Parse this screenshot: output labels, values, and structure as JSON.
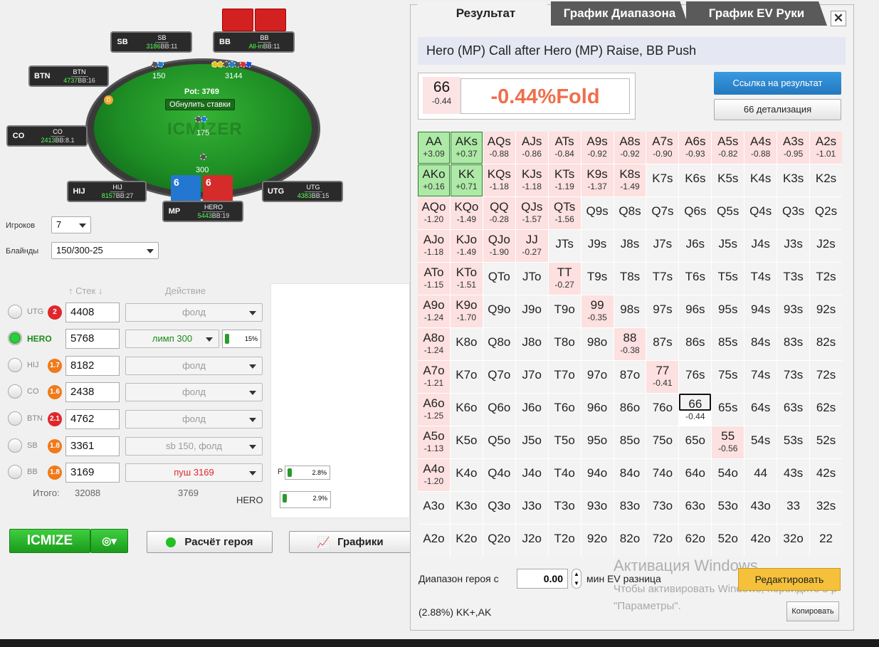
{
  "table": {
    "logo": "ICMIZER",
    "pot_label": "Pot: 3769",
    "reset_bets": "Обнулить ставки",
    "dealer": "D",
    "seats": {
      "sb": {
        "pos": "SB",
        "name": "SB",
        "stack": "3186",
        "bb": "BB:11"
      },
      "bb": {
        "pos": "BB",
        "name": "BB",
        "stack": "All-in",
        "bb": "BB:11"
      },
      "btn": {
        "pos": "BTN",
        "name": "BTN",
        "stack": "4737",
        "bb": "BB:16"
      },
      "co": {
        "pos": "CO",
        "name": "CO",
        "stack": "2413",
        "bb": "BB:8.1"
      },
      "hij": {
        "pos": "HIJ",
        "name": "HIJ",
        "stack": "8157",
        "bb": "BB:27"
      },
      "utg": {
        "pos": "UTG",
        "name": "UTG",
        "stack": "4383",
        "bb": "BB:15"
      },
      "mp": {
        "pos": "MP",
        "name": "HERO",
        "stack": "5443",
        "bb": "BB:19"
      }
    },
    "bets": {
      "sb": "150",
      "bb": "3144",
      "center": "175",
      "hero": "300"
    },
    "hero_cards": [
      "6",
      "6"
    ]
  },
  "controls": {
    "players_label": "Игроков",
    "players_value": "7",
    "blinds_label": "Блайнды",
    "blinds_value": "150/300-25",
    "stack_header": "Стек",
    "action_header": "Действие",
    "rows": [
      {
        "pos": "UTG",
        "badge": "2",
        "badge_color": "#e0262b",
        "stack": "4408",
        "action": "фолд",
        "color": "#999"
      },
      {
        "pos": "HERO",
        "badge": "",
        "badge_color": "",
        "stack": "5768",
        "action": "лимп 300",
        "color": "#1a8c1a",
        "pct": "15%"
      },
      {
        "pos": "HIJ",
        "badge": "1.7",
        "badge_color": "#f07a1a",
        "stack": "8182",
        "action": "фолд",
        "color": "#999"
      },
      {
        "pos": "CO",
        "badge": "1.6",
        "badge_color": "#f07a1a",
        "stack": "2438",
        "action": "фолд",
        "color": "#999"
      },
      {
        "pos": "BTN",
        "badge": "2.1",
        "badge_color": "#e0262b",
        "stack": "4762",
        "action": "фолд",
        "color": "#999"
      },
      {
        "pos": "SB",
        "badge": "1.8",
        "badge_color": "#f07a1a",
        "stack": "3361",
        "action": "sb 150, фолд",
        "color": "#999"
      },
      {
        "pos": "BB",
        "badge": "1.8",
        "badge_color": "#f07a1a",
        "stack": "3169",
        "action": "пуш 3169",
        "color": "#e0262b"
      }
    ],
    "total_label": "Итого:",
    "total_stack": "32088",
    "total_action": "3769",
    "p_label": "P",
    "p_pct": "2.8%",
    "hero_label": "HERO",
    "hero_pct": "2.9%",
    "icmize_btn": "ICMIZE",
    "hero_calc_btn": "Расчёт героя",
    "charts_btn": "Графики"
  },
  "panel": {
    "tabs": [
      "Результат",
      "График Диапазона",
      "График EV Руки"
    ],
    "close": "✕",
    "title": "Hero (MP) Call after Hero (MP) Raise, BB Push",
    "hand": "66",
    "hand_ev": "-0.44",
    "result": "-0.44%Fold",
    "link_btn": "Ссылка на результат",
    "detail_btn": "66 детализация",
    "grid": [
      [
        [
          "AA",
          "+3.09",
          "p"
        ],
        [
          "AKs",
          "+0.37",
          "p"
        ],
        [
          "AQs",
          "-0.88",
          "n"
        ],
        [
          "AJs",
          "-0.86",
          "n"
        ],
        [
          "ATs",
          "-0.84",
          "n"
        ],
        [
          "A9s",
          "-0.92",
          "n"
        ],
        [
          "A8s",
          "-0.92",
          "n"
        ],
        [
          "A7s",
          "-0.90",
          "n"
        ],
        [
          "A6s",
          "-0.93",
          "n"
        ],
        [
          "A5s",
          "-0.82",
          "n"
        ],
        [
          "A4s",
          "-0.88",
          "n"
        ],
        [
          "A3s",
          "-0.95",
          "n"
        ],
        [
          "A2s",
          "-1.01",
          "n"
        ]
      ],
      [
        [
          "AKo",
          "+0.16",
          "p"
        ],
        [
          "KK",
          "+0.71",
          "p"
        ],
        [
          "KQs",
          "-1.18",
          "n"
        ],
        [
          "KJs",
          "-1.18",
          "n"
        ],
        [
          "KTs",
          "-1.19",
          "n"
        ],
        [
          "K9s",
          "-1.37",
          "n"
        ],
        [
          "K8s",
          "-1.49",
          "n"
        ],
        [
          "K7s",
          "",
          ""
        ],
        [
          "K6s",
          "",
          ""
        ],
        [
          "K5s",
          "",
          ""
        ],
        [
          "K4s",
          "",
          ""
        ],
        [
          "K3s",
          "",
          ""
        ],
        [
          "K2s",
          "",
          ""
        ]
      ],
      [
        [
          "AQo",
          "-1.20",
          "n"
        ],
        [
          "KQo",
          "-1.49",
          "n"
        ],
        [
          "QQ",
          "-0.28",
          "n"
        ],
        [
          "QJs",
          "-1.57",
          "n"
        ],
        [
          "QTs",
          "-1.56",
          "n"
        ],
        [
          "Q9s",
          "",
          ""
        ],
        [
          "Q8s",
          "",
          ""
        ],
        [
          "Q7s",
          "",
          ""
        ],
        [
          "Q6s",
          "",
          ""
        ],
        [
          "Q5s",
          "",
          ""
        ],
        [
          "Q4s",
          "",
          ""
        ],
        [
          "Q3s",
          "",
          ""
        ],
        [
          "Q2s",
          "",
          ""
        ]
      ],
      [
        [
          "AJo",
          "-1.18",
          "n"
        ],
        [
          "KJo",
          "-1.49",
          "n"
        ],
        [
          "QJo",
          "-1.90",
          "n"
        ],
        [
          "JJ",
          "-0.27",
          "n"
        ],
        [
          "JTs",
          "",
          ""
        ],
        [
          "J9s",
          "",
          ""
        ],
        [
          "J8s",
          "",
          ""
        ],
        [
          "J7s",
          "",
          ""
        ],
        [
          "J6s",
          "",
          ""
        ],
        [
          "J5s",
          "",
          ""
        ],
        [
          "J4s",
          "",
          ""
        ],
        [
          "J3s",
          "",
          ""
        ],
        [
          "J2s",
          "",
          ""
        ]
      ],
      [
        [
          "ATo",
          "-1.15",
          "n"
        ],
        [
          "KTo",
          "-1.51",
          "n"
        ],
        [
          "QTo",
          "",
          ""
        ],
        [
          "JTo",
          "",
          ""
        ],
        [
          "TT",
          "-0.27",
          "n"
        ],
        [
          "T9s",
          "",
          ""
        ],
        [
          "T8s",
          "",
          ""
        ],
        [
          "T7s",
          "",
          ""
        ],
        [
          "T6s",
          "",
          ""
        ],
        [
          "T5s",
          "",
          ""
        ],
        [
          "T4s",
          "",
          ""
        ],
        [
          "T3s",
          "",
          ""
        ],
        [
          "T2s",
          "",
          ""
        ]
      ],
      [
        [
          "A9o",
          "-1.24",
          "n"
        ],
        [
          "K9o",
          "-1.70",
          "n"
        ],
        [
          "Q9o",
          "",
          ""
        ],
        [
          "J9o",
          "",
          ""
        ],
        [
          "T9o",
          "",
          ""
        ],
        [
          "99",
          "-0.35",
          "n"
        ],
        [
          "98s",
          "",
          ""
        ],
        [
          "97s",
          "",
          ""
        ],
        [
          "96s",
          "",
          ""
        ],
        [
          "95s",
          "",
          ""
        ],
        [
          "94s",
          "",
          ""
        ],
        [
          "93s",
          "",
          ""
        ],
        [
          "92s",
          "",
          ""
        ]
      ],
      [
        [
          "A8o",
          "-1.24",
          "n"
        ],
        [
          "K8o",
          "",
          ""
        ],
        [
          "Q8o",
          "",
          ""
        ],
        [
          "J8o",
          "",
          ""
        ],
        [
          "T8o",
          "",
          ""
        ],
        [
          "98o",
          "",
          ""
        ],
        [
          "88",
          "-0.38",
          "n"
        ],
        [
          "87s",
          "",
          ""
        ],
        [
          "86s",
          "",
          ""
        ],
        [
          "85s",
          "",
          ""
        ],
        [
          "84s",
          "",
          ""
        ],
        [
          "83s",
          "",
          ""
        ],
        [
          "82s",
          "",
          ""
        ]
      ],
      [
        [
          "A7o",
          "-1.21",
          "n"
        ],
        [
          "K7o",
          "",
          ""
        ],
        [
          "Q7o",
          "",
          ""
        ],
        [
          "J7o",
          "",
          ""
        ],
        [
          "T7o",
          "",
          ""
        ],
        [
          "97o",
          "",
          ""
        ],
        [
          "87o",
          "",
          ""
        ],
        [
          "77",
          "-0.41",
          "n"
        ],
        [
          "76s",
          "",
          ""
        ],
        [
          "75s",
          "",
          ""
        ],
        [
          "74s",
          "",
          ""
        ],
        [
          "73s",
          "",
          ""
        ],
        [
          "72s",
          "",
          ""
        ]
      ],
      [
        [
          "A6o",
          "-1.25",
          "n"
        ],
        [
          "K6o",
          "",
          ""
        ],
        [
          "Q6o",
          "",
          ""
        ],
        [
          "J6o",
          "",
          ""
        ],
        [
          "T6o",
          "",
          ""
        ],
        [
          "96o",
          "",
          ""
        ],
        [
          "86o",
          "",
          ""
        ],
        [
          "76o",
          "",
          ""
        ],
        [
          "66",
          "-0.44",
          "s"
        ],
        [
          "65s",
          "",
          ""
        ],
        [
          "64s",
          "",
          ""
        ],
        [
          "63s",
          "",
          ""
        ],
        [
          "62s",
          "",
          ""
        ]
      ],
      [
        [
          "A5o",
          "-1.13",
          "n"
        ],
        [
          "K5o",
          "",
          ""
        ],
        [
          "Q5o",
          "",
          ""
        ],
        [
          "J5o",
          "",
          ""
        ],
        [
          "T5o",
          "",
          ""
        ],
        [
          "95o",
          "",
          ""
        ],
        [
          "85o",
          "",
          ""
        ],
        [
          "75o",
          "",
          ""
        ],
        [
          "65o",
          "",
          ""
        ],
        [
          "55",
          "-0.56",
          "n"
        ],
        [
          "54s",
          "",
          ""
        ],
        [
          "53s",
          "",
          ""
        ],
        [
          "52s",
          "",
          ""
        ]
      ],
      [
        [
          "A4o",
          "-1.20",
          "n"
        ],
        [
          "K4o",
          "",
          ""
        ],
        [
          "Q4o",
          "",
          ""
        ],
        [
          "J4o",
          "",
          ""
        ],
        [
          "T4o",
          "",
          ""
        ],
        [
          "94o",
          "",
          ""
        ],
        [
          "84o",
          "",
          ""
        ],
        [
          "74o",
          "",
          ""
        ],
        [
          "64o",
          "",
          ""
        ],
        [
          "54o",
          "",
          ""
        ],
        [
          "44",
          "",
          ""
        ],
        [
          "43s",
          "",
          ""
        ],
        [
          "42s",
          "",
          ""
        ]
      ],
      [
        [
          "A3o",
          "",
          ""
        ],
        [
          "K3o",
          "",
          ""
        ],
        [
          "Q3o",
          "",
          ""
        ],
        [
          "J3o",
          "",
          ""
        ],
        [
          "T3o",
          "",
          ""
        ],
        [
          "93o",
          "",
          ""
        ],
        [
          "83o",
          "",
          ""
        ],
        [
          "73o",
          "",
          ""
        ],
        [
          "63o",
          "",
          ""
        ],
        [
          "53o",
          "",
          ""
        ],
        [
          "43o",
          "",
          ""
        ],
        [
          "33",
          "",
          ""
        ],
        [
          "32s",
          "",
          ""
        ]
      ],
      [
        [
          "A2o",
          "",
          ""
        ],
        [
          "K2o",
          "",
          ""
        ],
        [
          "Q2o",
          "",
          ""
        ],
        [
          "J2o",
          "",
          ""
        ],
        [
          "T2o",
          "",
          ""
        ],
        [
          "92o",
          "",
          ""
        ],
        [
          "82o",
          "",
          ""
        ],
        [
          "72o",
          "",
          ""
        ],
        [
          "62o",
          "",
          ""
        ],
        [
          "52o",
          "",
          ""
        ],
        [
          "42o",
          "",
          ""
        ],
        [
          "32o",
          "",
          ""
        ],
        [
          "22",
          "",
          ""
        ]
      ]
    ],
    "range_label": "Диапазон героя с",
    "ev_value": "0.00",
    "ev_label": "мин EV разница",
    "edit_btn": "Редактировать",
    "copy_btn": "Копировать",
    "range_text": "(2.88%) KK+,AK"
  },
  "windows_activation": {
    "title": "Активация Windows",
    "line1": "Чтобы активировать Windows, перейдите в р",
    "line2": "\"Параметры\"."
  }
}
